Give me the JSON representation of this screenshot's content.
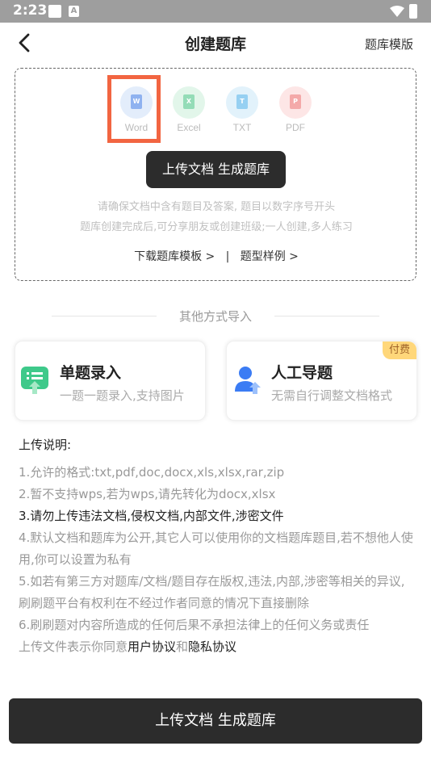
{
  "status": {
    "time": "2:23",
    "sim_icon_label": "A"
  },
  "header": {
    "back": "back",
    "title": "创建题库",
    "template_link": "题库模版"
  },
  "formats": [
    {
      "label": "Word",
      "letter": "W",
      "color": "#cfe0f7",
      "doc_color": "#5b8def"
    },
    {
      "label": "Excel",
      "letter": "X",
      "color": "#d6f1e1",
      "doc_color": "#4cc38a"
    },
    {
      "label": "TXT",
      "letter": "T",
      "color": "#d6ecf8",
      "doc_color": "#56b4ea"
    },
    {
      "label": "PDF",
      "letter": "P",
      "color": "#fbdcdc",
      "doc_color": "#f07f7f"
    }
  ],
  "upload": {
    "button": "上传文档 生成题库",
    "hint1": "请确保文档中含有题目及答案, 题目以数字序号开头",
    "hint2": "题库创建完成后,可分享朋友或创建班级;一人创建,多人练习",
    "download_link": "下载题库模板 >",
    "separator": "|",
    "sample_link": "题型样例 >"
  },
  "other": {
    "divider": "其他方式导入",
    "single": {
      "title": "单题录入",
      "desc": "一题一题录入,支持图片"
    },
    "manual": {
      "title": "人工导题",
      "desc": "无需自行调整文档格式",
      "badge": "付费"
    }
  },
  "notes": {
    "title": "上传说明:",
    "items": [
      "1.允许的格式:txt,pdf,doc,docx,xls,xlsx,rar,zip",
      "2.暂不支持wps,若为wps,请先转化为docx,xlsx",
      "3.请勿上传违法文档,侵权文档,内部文件,涉密文件",
      "4.默认文档和题库为公开,其它人可以使用你的文档题库题目,若不想他人使用,你可以设置为私有",
      "5.如若有第三方对题库/文档/题目存在版权,违法,内部,涉密等相关的异议,刷刷题平台有权利在不经过作者同意的情况下直接删除",
      "6.刷刷题对内容所造成的任何后果不承担法律上的任何义务或责任"
    ],
    "agree_prefix": "上传文件表示你同意",
    "user_agreement": "用户协议",
    "and": "和",
    "privacy": "隐私协议"
  },
  "bottom_button": "上传文档 生成题库"
}
